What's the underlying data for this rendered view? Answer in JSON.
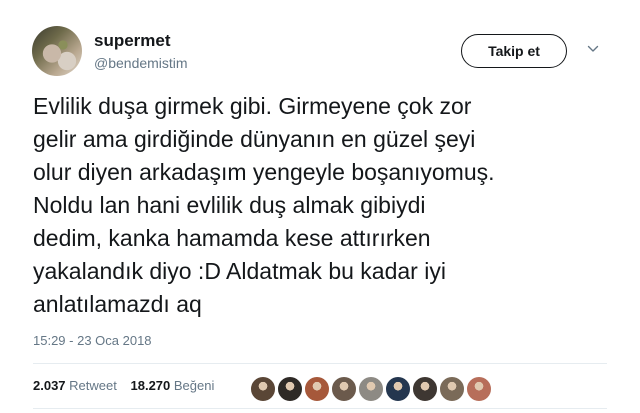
{
  "user": {
    "display_name": "supermet",
    "handle": "@bendemistim"
  },
  "follow_button": {
    "label": "Takip et"
  },
  "tweet": {
    "text": "Evlilik duşa girmek gibi. Girmeyene çok zor\ngelir ama girdiğinde dünyanın en güzel şeyi\nolur diyen arkadaşım yengeyle boşanıyomuş.\nNoldu lan hani evlilik duş almak gibiydi\ndedim, kanka hamamda kese attırırken\nyakalandık diyo :D Aldatmak bu kadar iyi\nanlatılamazdı aq",
    "timestamp": "15:29 - 23 Oca 2018"
  },
  "stats": {
    "retweets": "2.037",
    "retweets_label": "Retweet",
    "likes": "18.270",
    "likes_label": "Beğeni"
  },
  "likers": [
    {
      "name": "liker-avatar-1",
      "color": "#5a4636"
    },
    {
      "name": "liker-avatar-2",
      "color": "#2e2a26"
    },
    {
      "name": "liker-avatar-3",
      "color": "#a6583a"
    },
    {
      "name": "liker-avatar-4",
      "color": "#6b5a4c"
    },
    {
      "name": "liker-avatar-5",
      "color": "#8d8a84"
    },
    {
      "name": "liker-avatar-6",
      "color": "#24364f"
    },
    {
      "name": "liker-avatar-7",
      "color": "#3e3732"
    },
    {
      "name": "liker-avatar-8",
      "color": "#7a6a58"
    },
    {
      "name": "liker-avatar-9",
      "color": "#b76e5a"
    }
  ],
  "colors": {
    "text": "#14171a",
    "secondary": "#657786",
    "divider": "#e6ecf0"
  }
}
